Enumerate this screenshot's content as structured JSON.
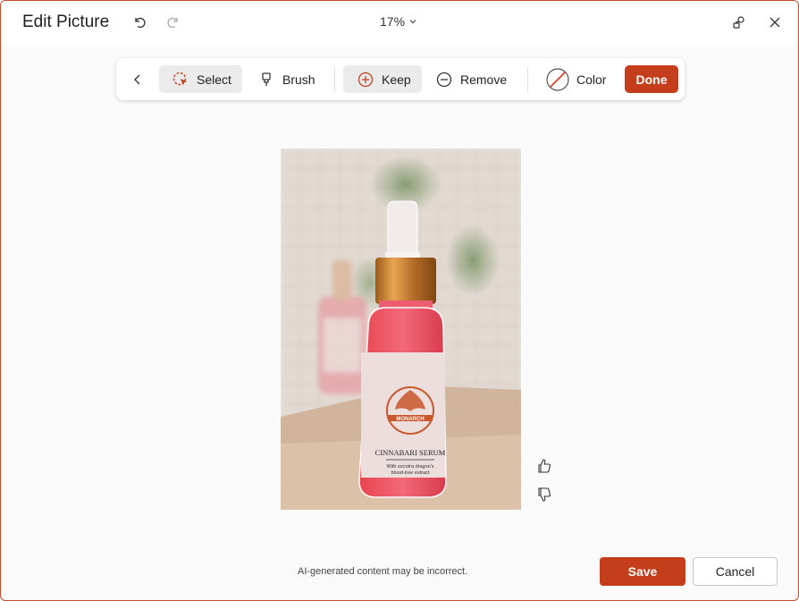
{
  "window": {
    "title": "Edit Picture"
  },
  "zoom": {
    "value": "17%"
  },
  "toolbar": {
    "select_label": "Select",
    "brush_label": "Brush",
    "keep_label": "Keep",
    "remove_label": "Remove",
    "color_label": "Color",
    "done_label": "Done"
  },
  "product": {
    "brand": "MONARCH",
    "name": "CINNABARI SERUM",
    "tagline_line1": "With socotra dragon's",
    "tagline_line2": "blood-tree extract"
  },
  "footer": {
    "disclaimer": "AI-generated content may be incorrect.",
    "save_label": "Save",
    "cancel_label": "Cancel"
  },
  "colors": {
    "accent": "#c43e1c",
    "border": "#c84b2f"
  },
  "icons": [
    "undo-icon",
    "redo-icon",
    "chevron-down-icon",
    "share-icon",
    "close-icon",
    "back-icon",
    "select-icon",
    "brush-icon",
    "keep-icon",
    "remove-icon",
    "color-icon",
    "thumbs-up-icon",
    "thumbs-down-icon"
  ]
}
